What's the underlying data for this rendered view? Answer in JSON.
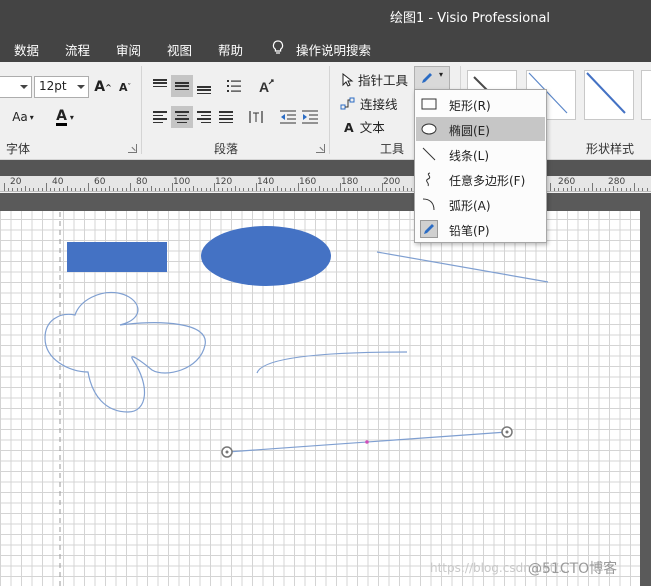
{
  "window": {
    "title": "绘图1  -  Visio Professional"
  },
  "menu": {
    "items": [
      "数据",
      "流程",
      "审阅",
      "视图",
      "帮助"
    ],
    "tell_me": "操作说明搜索"
  },
  "ribbon": {
    "font": {
      "size_value": "12pt",
      "grow_label": "A",
      "shrink_label": "A",
      "aa_label": "Aa",
      "color_label": "A",
      "group_label": "字体"
    },
    "paragraph": {
      "group_label": "段落"
    },
    "tools": {
      "pointer": "指针工具",
      "connector": "连接线",
      "text": "文本",
      "text_icon": "A",
      "group_label": "工具"
    },
    "shape_styles": {
      "group_label": "形状样式"
    }
  },
  "ruler": {
    "labels": [
      "20",
      "40",
      "60",
      "80",
      "100",
      "120",
      "140",
      "160",
      "180",
      "200",
      "220",
      "240",
      "260",
      "280"
    ]
  },
  "draw_menu": {
    "items": [
      {
        "label": "矩形(R)",
        "icon": "rectangle-icon"
      },
      {
        "label": "椭圆(E)",
        "icon": "ellipse-icon",
        "selected": true
      },
      {
        "label": "线条(L)",
        "icon": "line-icon"
      },
      {
        "label": "任意多边形(F)",
        "icon": "freeform-icon"
      },
      {
        "label": "弧形(A)",
        "icon": "arc-icon"
      },
      {
        "label": "铅笔(P)",
        "icon": "pencil-icon"
      }
    ]
  },
  "colors": {
    "title_bar": "#444444",
    "shape_fill": "#4472c4",
    "line_stroke": "#7f9fd1",
    "canvas_bg": "#5a5a5a"
  },
  "watermark": {
    "left": "https://blog.csdn.net/...",
    "right": "@51CTO博客"
  }
}
